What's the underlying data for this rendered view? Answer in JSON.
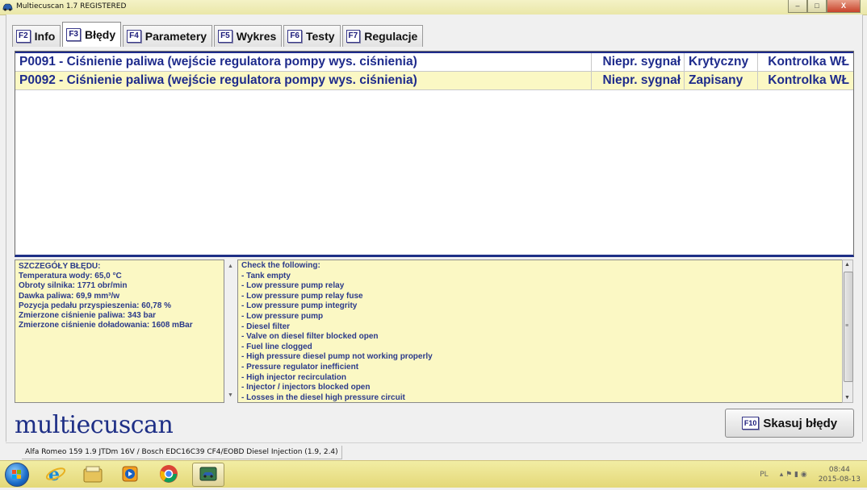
{
  "window": {
    "title": "Multiecuscan 1.7 REGISTERED",
    "minimize": "–",
    "maximize": "□",
    "close": "X"
  },
  "tabs": [
    {
      "key": "F2",
      "label": "Info",
      "active": false
    },
    {
      "key": "F3",
      "label": "Błędy",
      "active": true
    },
    {
      "key": "F4",
      "label": "Parametery",
      "active": false
    },
    {
      "key": "F5",
      "label": "Wykres",
      "active": false
    },
    {
      "key": "F6",
      "label": "Testy",
      "active": false
    },
    {
      "key": "F7",
      "label": "Regulacje",
      "active": false
    }
  ],
  "faults": [
    {
      "description": "P0091 - Ciśnienie paliwa (wejście regulatora pompy wys. ciśnienia)",
      "signal": "Niepr. sygnał",
      "status": "Krytyczny",
      "lamp": "Kontrolka WŁ",
      "selected": false
    },
    {
      "description": "P0092 - Ciśnienie paliwa (wejście regulatora pompy wys. ciśnienia)",
      "signal": "Niepr. sygnał",
      "status": "Zapisany",
      "lamp": "Kontrolka WŁ",
      "selected": true
    }
  ],
  "details": {
    "heading": "SZCZEGÓŁY BŁĘDU:",
    "lines": [
      "Temperatura wody: 65,0 °C",
      "Obroty silnika: 1771 obr/min",
      "Dawka paliwa: 69,9 mm³/w",
      "Pozycja pedału przyspieszenia: 60,78 %",
      "Zmierzone ciśnienie paliwa: 343 bar",
      "Zmierzone ciśnienie doładowania: 1608 mBar"
    ]
  },
  "checklist": {
    "heading": "Check the following:",
    "items": [
      "- Tank empty",
      "- Low pressure pump relay",
      "- Low pressure pump relay fuse",
      "- Low pressure pump integrity",
      "- Low pressure pump",
      "- Diesel filter",
      "- Valve on diesel filter blocked open",
      "- Fuel line clogged",
      "- High pressure diesel pump not working properly",
      "- Pressure regulator inefficient",
      "- High injector recirculation",
      "- Injector / injectors blocked open",
      "- Losses in the diesel high pressure circuit"
    ]
  },
  "logo": "multiecuscan",
  "clear_button": {
    "key": "F10",
    "label": "Skasuj błędy"
  },
  "status": "Alfa Romeo 159 1.9 JTDm 16V / Bosch EDC16C39 CF4/EOBD Diesel Injection (1.9, 2.4)",
  "taskbar": {
    "language": "PL",
    "time": "08:44",
    "date": "2015-08-13"
  },
  "colors": {
    "accent": "#1e2b8c",
    "panel_yellow": "#fbf8c4",
    "taskbar": "#efe9a0"
  }
}
